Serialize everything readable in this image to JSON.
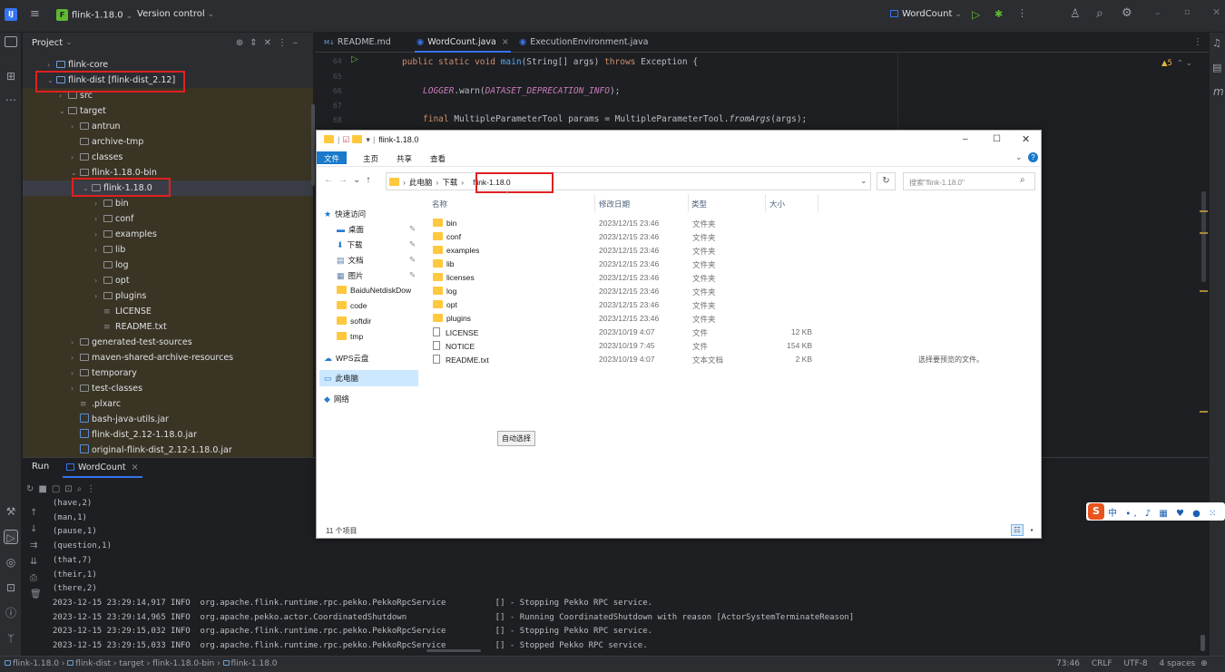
{
  "titlebar": {
    "project_badge": "F",
    "project_name": "flink-1.18.0",
    "vcs": "Version control",
    "run_config": "WordCount"
  },
  "project_panel": {
    "title": "Project",
    "tree": [
      {
        "label": "flink-core",
        "indent": 1,
        "arrow": "›",
        "type": "module"
      },
      {
        "label": "flink-dist [flink-dist_2.12]",
        "indent": 1,
        "arrow": "⌄",
        "type": "module"
      },
      {
        "label": "src",
        "indent": 2,
        "arrow": "›",
        "type": "folder"
      },
      {
        "label": "target",
        "indent": 2,
        "arrow": "⌄",
        "type": "folder"
      },
      {
        "label": "antrun",
        "indent": 3,
        "arrow": "›",
        "type": "folder"
      },
      {
        "label": "archive-tmp",
        "indent": 3,
        "arrow": "",
        "type": "folder"
      },
      {
        "label": "classes",
        "indent": 3,
        "arrow": "›",
        "type": "folder"
      },
      {
        "label": "flink-1.18.0-bin",
        "indent": 3,
        "arrow": "⌄",
        "type": "folder"
      },
      {
        "label": "flink-1.18.0",
        "indent": 4,
        "arrow": "⌄",
        "type": "folder"
      },
      {
        "label": "bin",
        "indent": 5,
        "arrow": "›",
        "type": "folder"
      },
      {
        "label": "conf",
        "indent": 5,
        "arrow": "›",
        "type": "folder"
      },
      {
        "label": "examples",
        "indent": 5,
        "arrow": "›",
        "type": "folder"
      },
      {
        "label": "lib",
        "indent": 5,
        "arrow": "›",
        "type": "folder"
      },
      {
        "label": "log",
        "indent": 5,
        "arrow": "",
        "type": "folder"
      },
      {
        "label": "opt",
        "indent": 5,
        "arrow": "›",
        "type": "folder"
      },
      {
        "label": "plugins",
        "indent": 5,
        "arrow": "›",
        "type": "folder"
      },
      {
        "label": "LICENSE",
        "indent": 5,
        "arrow": "",
        "type": "text"
      },
      {
        "label": "README.txt",
        "indent": 5,
        "arrow": "",
        "type": "text"
      },
      {
        "label": "generated-test-sources",
        "indent": 3,
        "arrow": "›",
        "type": "folder"
      },
      {
        "label": "maven-shared-archive-resources",
        "indent": 3,
        "arrow": "›",
        "type": "folder"
      },
      {
        "label": "temporary",
        "indent": 3,
        "arrow": "›",
        "type": "folder"
      },
      {
        "label": "test-classes",
        "indent": 3,
        "arrow": "›",
        "type": "folder"
      },
      {
        "label": ".plxarc",
        "indent": 3,
        "arrow": "",
        "type": "text"
      },
      {
        "label": "bash-java-utils.jar",
        "indent": 3,
        "arrow": "",
        "type": "jar"
      },
      {
        "label": "flink-dist_2.12-1.18.0.jar",
        "indent": 3,
        "arrow": "",
        "type": "jar"
      },
      {
        "label": "original-flink-dist_2.12-1.18.0.jar",
        "indent": 3,
        "arrow": "",
        "type": "jar"
      }
    ]
  },
  "editor": {
    "tabs": [
      {
        "label": "README.md",
        "prefix": "M↓",
        "active": false,
        "closable": false
      },
      {
        "label": "WordCount.java",
        "prefix": "",
        "active": true,
        "closable": true
      },
      {
        "label": "ExecutionEnvironment.java",
        "prefix": "",
        "active": false,
        "closable": false
      }
    ],
    "line_numbers": [
      "64",
      "65",
      "66",
      "67",
      "68"
    ],
    "code": {
      "l64_kw1": "public static void ",
      "l64_fn": "main",
      "l64_rest": "(String[] args) ",
      "l64_kw2": "throws ",
      "l64_tail": "Exception {",
      "l66_a": "LOGGER",
      "l66_b": ".warn(",
      "l66_c": "DATASET_DEPRECATION_INFO",
      "l66_d": ");",
      "l68_kw": "final ",
      "l68_a": "MultipleParameterTool params = MultipleParameterTool.",
      "l68_b": "fromArgs",
      "l68_c": "(args);"
    },
    "warnings": "▲5"
  },
  "run_panel": {
    "title": "Run",
    "tab": "WordCount",
    "logs": [
      "(have,2)",
      "(man,1)",
      "(pause,1)",
      "(question,1)",
      "(that,7)",
      "(their,1)",
      "(there,2)",
      "2023-12-15 23:29:14,917 INFO  org.apache.flink.runtime.rpc.pekko.PekkoRpcService          [] - Stopping Pekko RPC service.",
      "2023-12-15 23:29:14,965 INFO  org.apache.pekko.actor.CoordinatedShutdown                  [] - Running CoordinatedShutdown with reason [ActorSystemTerminateReason]",
      "2023-12-15 23:29:15,032 INFO  org.apache.flink.runtime.rpc.pekko.PekkoRpcService          [] - Stopping Pekko RPC service.",
      "2023-12-15 23:29:15,033 INFO  org.apache.flink.runtime.rpc.pekko.PekkoRpcService          [] - Stopped Pekko RPC service."
    ]
  },
  "statusbar": {
    "crumbs": [
      "flink-1.18.0",
      "flink-dist",
      "target",
      "flink-1.18.0-bin",
      "flink-1.18.0"
    ],
    "position": "73:46",
    "line_sep": "CRLF",
    "encoding": "UTF-8",
    "indent": "4 spaces"
  },
  "explorer": {
    "title": "flink-1.18.0",
    "ribbon": [
      "文件",
      "主页",
      "共享",
      "查看"
    ],
    "breadcrumb": [
      "此电脑",
      "下载",
      "flink-1.18.0"
    ],
    "search_placeholder": "搜索\"flink-1.18.0\"",
    "columns": [
      "名称",
      "修改日期",
      "类型",
      "大小"
    ],
    "nav": [
      {
        "label": "快速访问",
        "pin": false,
        "icon": "star"
      },
      {
        "label": "桌面",
        "pin": true,
        "icon": "desktop"
      },
      {
        "label": "下载",
        "pin": true,
        "icon": "download"
      },
      {
        "label": "文档",
        "pin": true,
        "icon": "doc"
      },
      {
        "label": "图片",
        "pin": true,
        "icon": "pic"
      },
      {
        "label": "BaiduNetdiskDow",
        "pin": false,
        "icon": "folder"
      },
      {
        "label": "code",
        "pin": false,
        "icon": "folder"
      },
      {
        "label": "softdir",
        "pin": false,
        "icon": "folder"
      },
      {
        "label": "tmp",
        "pin": false,
        "icon": "folder"
      },
      {
        "label": "WPS云盘",
        "pin": false,
        "icon": "cloud"
      },
      {
        "label": "此电脑",
        "pin": false,
        "icon": "pc"
      },
      {
        "label": "网络",
        "pin": false,
        "icon": "network"
      }
    ],
    "files": [
      {
        "name": "bin",
        "date": "2023/12/15 23:46",
        "type": "文件夹",
        "size": "",
        "folder": true
      },
      {
        "name": "conf",
        "date": "2023/12/15 23:46",
        "type": "文件夹",
        "size": "",
        "folder": true
      },
      {
        "name": "examples",
        "date": "2023/12/15 23:46",
        "type": "文件夹",
        "size": "",
        "folder": true
      },
      {
        "name": "lib",
        "date": "2023/12/15 23:46",
        "type": "文件夹",
        "size": "",
        "folder": true
      },
      {
        "name": "licenses",
        "date": "2023/12/15 23:46",
        "type": "文件夹",
        "size": "",
        "folder": true
      },
      {
        "name": "log",
        "date": "2023/12/15 23:46",
        "type": "文件夹",
        "size": "",
        "folder": true
      },
      {
        "name": "opt",
        "date": "2023/12/15 23:46",
        "type": "文件夹",
        "size": "",
        "folder": true
      },
      {
        "name": "plugins",
        "date": "2023/12/15 23:46",
        "type": "文件夹",
        "size": "",
        "folder": true
      },
      {
        "name": "LICENSE",
        "date": "2023/10/19 4:07",
        "type": "文件",
        "size": "12 KB",
        "folder": false
      },
      {
        "name": "NOTICE",
        "date": "2023/10/19 7:45",
        "type": "文件",
        "size": "154 KB",
        "folder": false
      },
      {
        "name": "README.txt",
        "date": "2023/10/19 4:07",
        "type": "文本文档",
        "size": "2 KB",
        "folder": false
      }
    ],
    "preview_hint": "选择要预览的文件。",
    "auto_select": "自动选择",
    "item_count": "11 个项目"
  },
  "colors": {
    "ide_bg": "#1e1f22",
    "panel_bg": "#2b2d30",
    "accent": "#3574f0",
    "highlight_box": "#e02020",
    "folder_yellow": "#ffc83d"
  }
}
